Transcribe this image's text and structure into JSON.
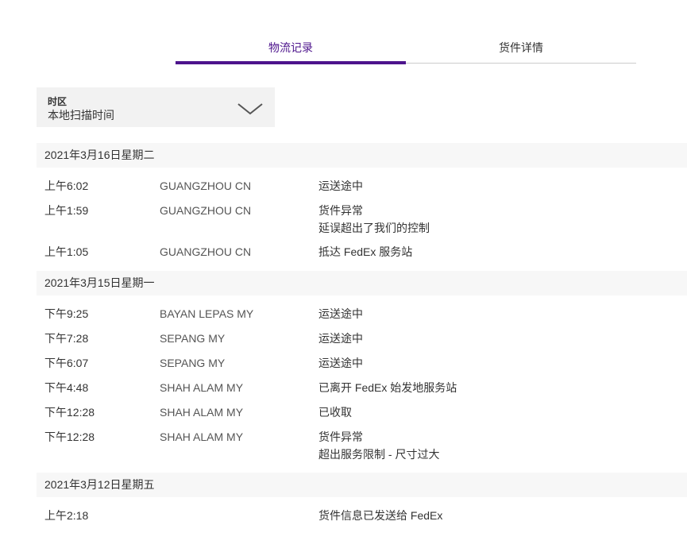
{
  "tabs": [
    {
      "label": "物流记录",
      "active": true
    },
    {
      "label": "货件详情",
      "active": false
    }
  ],
  "timezone": {
    "label": "时区",
    "value": "本地扫描时间",
    "icon": "chevron-down-icon"
  },
  "colors": {
    "accent": "#4d148c",
    "date_row_bg": "#f7f7f7",
    "select_bg": "#f2f2f2"
  },
  "groups": [
    {
      "date": "2021年3月16日星期二",
      "events": [
        {
          "time": "上午6:02",
          "location": "GUANGZHOU CN",
          "status": [
            "运送途中"
          ]
        },
        {
          "time": "上午1:59",
          "location": "GUANGZHOU CN",
          "status": [
            "货件异常",
            "延误超出了我们的控制"
          ]
        },
        {
          "time": "上午1:05",
          "location": "GUANGZHOU CN",
          "status": [
            "抵达 FedEx 服务站"
          ]
        }
      ]
    },
    {
      "date": "2021年3月15日星期一",
      "events": [
        {
          "time": "下午9:25",
          "location": "BAYAN LEPAS MY",
          "status": [
            "运送途中"
          ]
        },
        {
          "time": "下午7:28",
          "location": "SEPANG MY",
          "status": [
            "运送途中"
          ]
        },
        {
          "time": "下午6:07",
          "location": "SEPANG MY",
          "status": [
            "运送途中"
          ]
        },
        {
          "time": "下午4:48",
          "location": "SHAH ALAM MY",
          "status": [
            "已离开 FedEx 始发地服务站"
          ]
        },
        {
          "time": "下午12:28",
          "location": "SHAH ALAM MY",
          "status": [
            "已收取"
          ]
        },
        {
          "time": "下午12:28",
          "location": "SHAH ALAM MY",
          "status": [
            "货件异常",
            "超出服务限制 - 尺寸过大"
          ]
        }
      ]
    },
    {
      "date": "2021年3月12日星期五",
      "events": [
        {
          "time": "上午2:18",
          "location": "",
          "status": [
            "货件信息已发送给 FedEx"
          ]
        }
      ]
    }
  ]
}
